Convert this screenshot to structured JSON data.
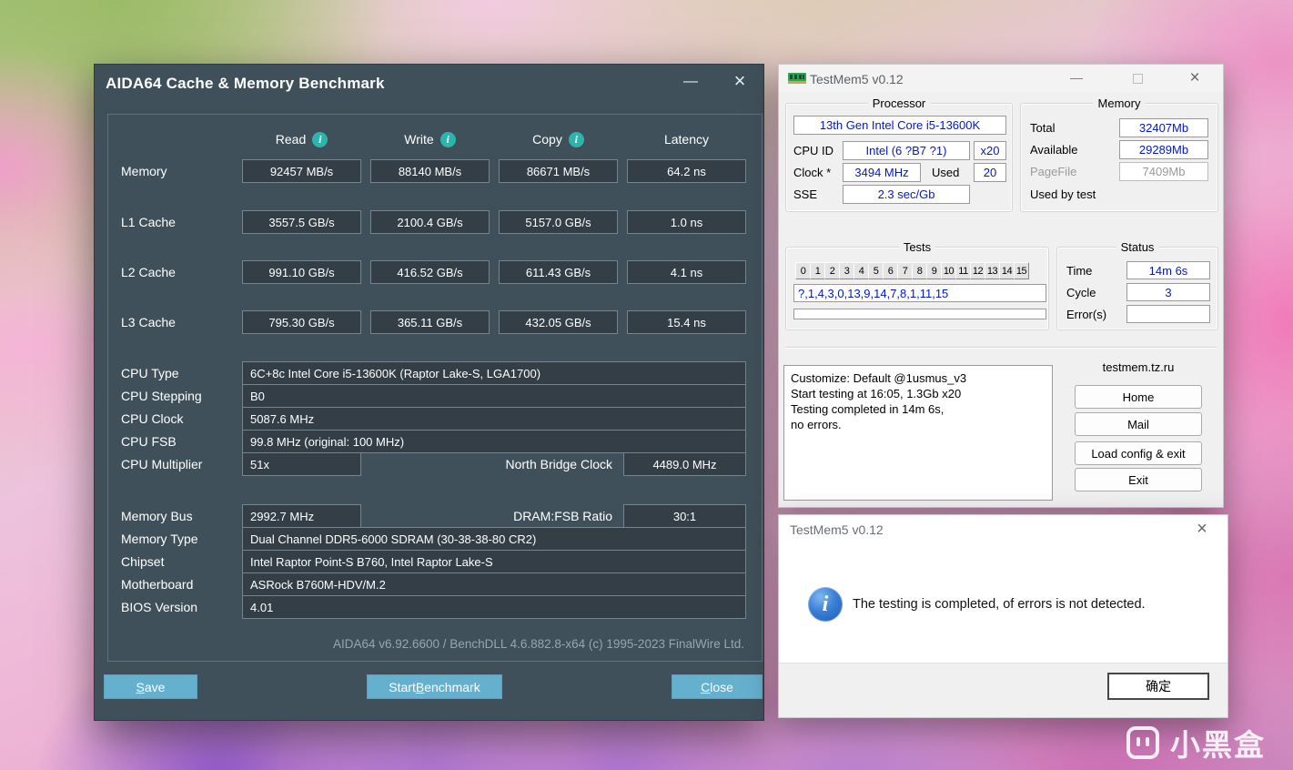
{
  "glyphs": {
    "minimize": "—",
    "close": "×",
    "info": "i"
  },
  "colors": {
    "aida_window_bg": "#40505a",
    "aida_value_box_bg": "#333e47",
    "aida_button_blue": "#66b0cf",
    "info_badge_teal": "#2cb5ac",
    "testmem_value_blue": "#0018c8",
    "dialog_icon_blue": "#2f6fc4"
  },
  "aida64": {
    "title": "AIDA64 Cache & Memory Benchmark",
    "columns": [
      "Read",
      "Write",
      "Copy",
      "Latency"
    ],
    "bench_rows": [
      {
        "label": "Memory",
        "read": "92457 MB/s",
        "write": "88140 MB/s",
        "copy": "86671 MB/s",
        "latency": "64.2 ns"
      },
      {
        "label": "L1 Cache",
        "read": "3557.5 GB/s",
        "write": "2100.4 GB/s",
        "copy": "5157.0 GB/s",
        "latency": "1.0 ns"
      },
      {
        "label": "L2 Cache",
        "read": "991.10 GB/s",
        "write": "416.52 GB/s",
        "copy": "611.43 GB/s",
        "latency": "4.1 ns"
      },
      {
        "label": "L3 Cache",
        "read": "795.30 GB/s",
        "write": "365.11 GB/s",
        "copy": "432.05 GB/s",
        "latency": "15.4 ns"
      }
    ],
    "fields": [
      {
        "label": "CPU Type",
        "value": "6C+8c Intel Core i5-13600K  (Raptor Lake-S, LGA1700)"
      },
      {
        "label": "CPU Stepping",
        "value": "B0"
      },
      {
        "label": "CPU Clock",
        "value": "5087.6 MHz"
      },
      {
        "label": "CPU FSB",
        "value": "99.8 MHz  (original: 100 MHz)"
      }
    ],
    "multiplier": {
      "label": "CPU Multiplier",
      "value": "51x",
      "nb_label": "North Bridge Clock",
      "nb_value": "4489.0 MHz"
    },
    "membus": {
      "label": "Memory Bus",
      "value": "2992.7 MHz",
      "ratio_label": "DRAM:FSB Ratio",
      "ratio_value": "30:1"
    },
    "fields2": [
      {
        "label": "Memory Type",
        "value": "Dual Channel DDR5-6000 SDRAM  (30-38-38-80 CR2)"
      },
      {
        "label": "Chipset",
        "value": "Intel Raptor Point-S B760, Intel Raptor Lake-S"
      },
      {
        "label": "Motherboard",
        "value": "ASRock B760M-HDV/M.2"
      },
      {
        "label": "BIOS Version",
        "value": "4.01"
      }
    ],
    "footer": "AIDA64 v6.92.6600 / BenchDLL 4.6.882.8-x64  (c) 1995-2023 FinalWire Ltd.",
    "buttons": {
      "save": {
        "pre": "",
        "key": "S",
        "post": "ave"
      },
      "start": {
        "pre": "Start ",
        "key": "B",
        "post": "enchmark"
      },
      "close": {
        "pre": "",
        "key": "C",
        "post": "lose"
      }
    }
  },
  "testmem5": {
    "title": "TestMem5 v0.12",
    "processor": {
      "group_label": "Processor",
      "cpu_name": "13th Gen Intel Core i5-13600K",
      "cpu_id_label": "CPU ID",
      "cpu_id_value": "Intel  (6 ?B7 ?1)",
      "cpu_id_mult": "x20",
      "clock_label": "Clock *",
      "clock_value": "3494 MHz",
      "used_label": "Used",
      "used_value": "20",
      "sse_label": "SSE",
      "sse_value": "2.3 sec/Gb"
    },
    "memory": {
      "group_label": "Memory",
      "total_label": "Total",
      "total_value": "32407Mb",
      "available_label": "Available",
      "available_value": "29289Mb",
      "pagefile_label": "PageFile",
      "pagefile_value": "7409Mb",
      "used_by_test_label": "Used by test"
    },
    "tests": {
      "group_label": "Tests",
      "cells": [
        "0",
        "1",
        "2",
        "3",
        "4",
        "5",
        "6",
        "7",
        "8",
        "9",
        "10",
        "11",
        "12",
        "13",
        "14",
        "15"
      ],
      "sequence": "?,1,4,3,0,13,9,14,7,8,1,11,15"
    },
    "status": {
      "group_label": "Status",
      "time_label": "Time",
      "time_value": "14m 6s",
      "cycle_label": "Cycle",
      "cycle_value": "3",
      "errors_label": "Error(s)",
      "errors_value": ""
    },
    "log_lines": [
      "Customize: Default @1usmus_v3",
      "Start testing at 16:05, 1.3Gb x20",
      "Testing completed in 14m 6s,",
      "no errors."
    ],
    "site": "testmem.tz.ru",
    "buttons": [
      "Home",
      "Mail",
      "Load config & exit",
      "Exit"
    ]
  },
  "dialog": {
    "title": "TestMem5 v0.12",
    "message": "The testing is completed, of errors is not detected.",
    "ok_label": "确定"
  },
  "watermark": {
    "text": "小黑盒"
  }
}
